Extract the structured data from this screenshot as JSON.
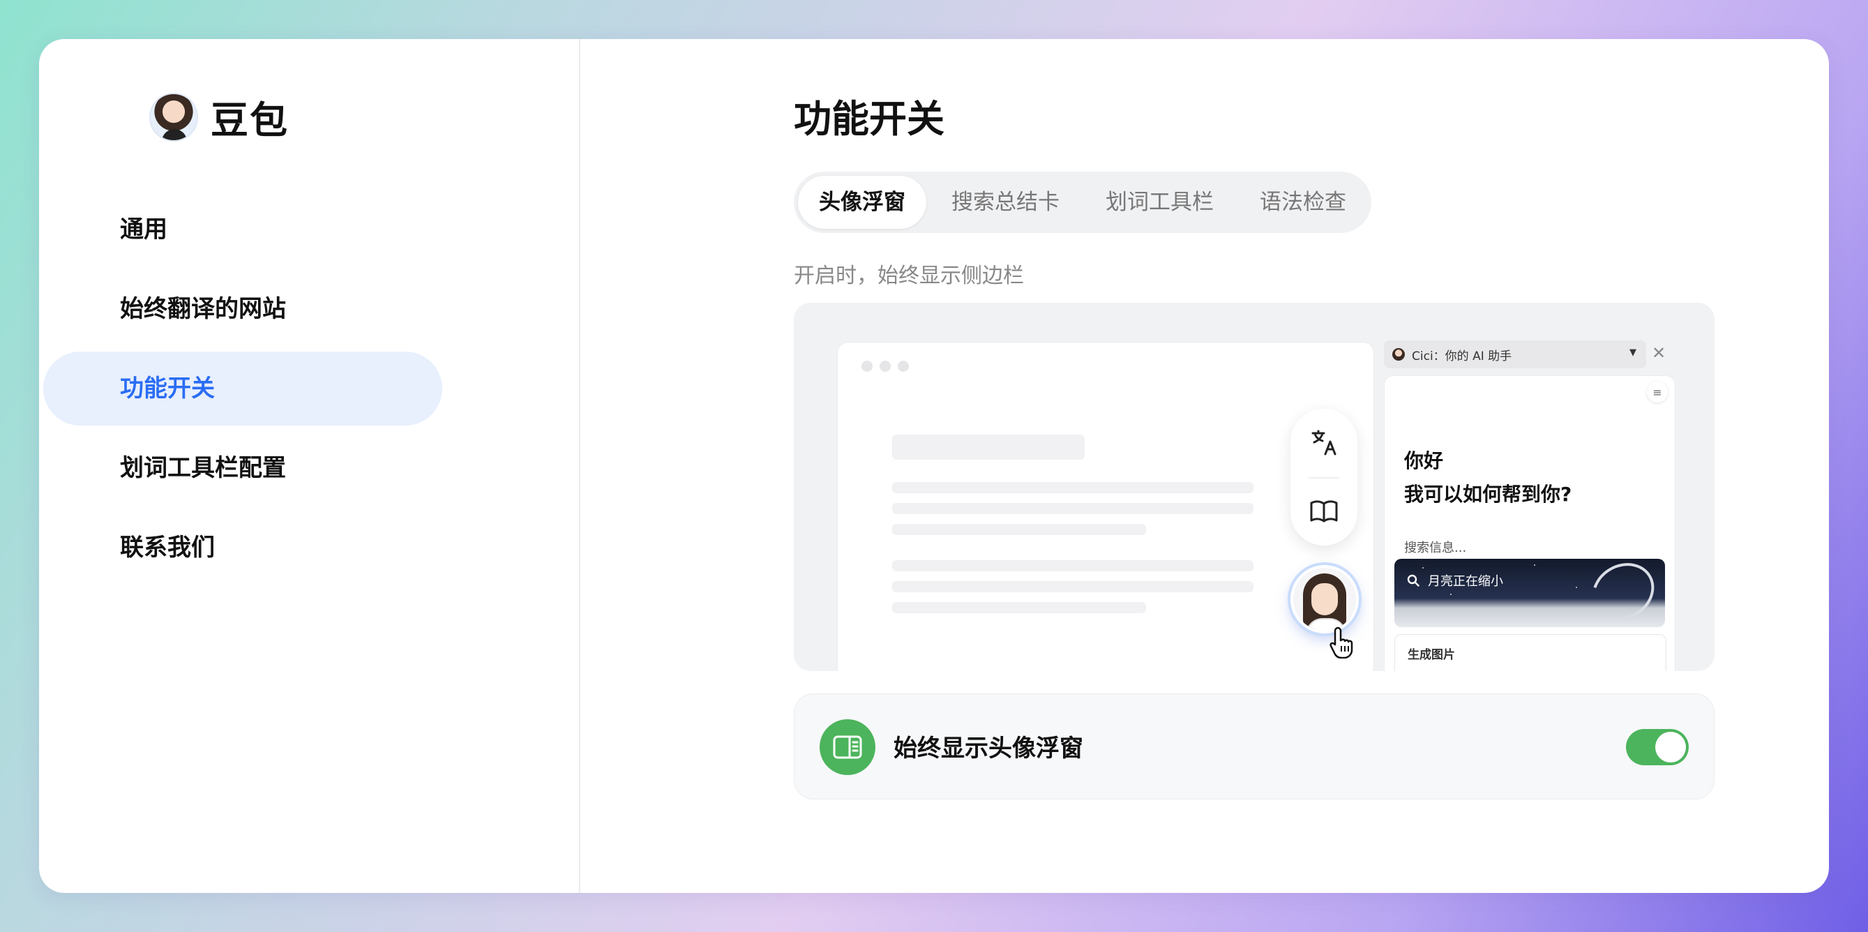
{
  "app": {
    "name": "豆包",
    "avatar_icon": "user-avatar-icon"
  },
  "sidebar": {
    "items": [
      {
        "label": "通用",
        "active": false
      },
      {
        "label": "始终翻译的网站",
        "active": false
      },
      {
        "label": "功能开关",
        "active": true
      },
      {
        "label": "划词工具栏配置",
        "active": false
      },
      {
        "label": "联系我们",
        "active": false
      }
    ]
  },
  "main": {
    "title": "功能开关",
    "tabs": [
      {
        "label": "头像浮窗",
        "active": true
      },
      {
        "label": "搜索总结卡",
        "active": false
      },
      {
        "label": "划词工具栏",
        "active": false
      },
      {
        "label": "语法检查",
        "active": false
      }
    ],
    "description": "开启时，始终显示侧边栏",
    "preview": {
      "side_header": "Cici：你的 AI 助手",
      "greeting_line1": "你好",
      "greeting_line2": "我可以如何帮到你?",
      "search_label": "搜索信息...",
      "search_query": "月亮正在缩小",
      "gen_label": "生成图片",
      "icons": [
        "translate-icon",
        "book-icon",
        "cursor-hand-icon",
        "close-icon",
        "menu-icon",
        "search-icon"
      ]
    },
    "setting": {
      "label": "始终显示头像浮窗",
      "enabled": true,
      "icon": "sidebar-panel-icon"
    }
  },
  "colors": {
    "accent_blue": "#2a6df4",
    "nav_active_bg": "#e8effd",
    "toggle_green": "#4cb45c"
  }
}
